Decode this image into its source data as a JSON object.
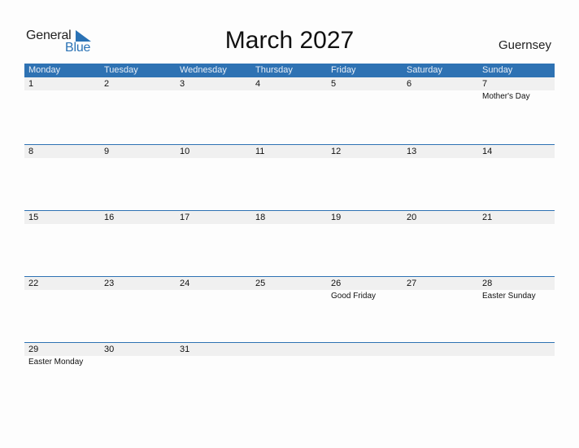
{
  "logo": {
    "word1": "General",
    "word2": "Blue",
    "icon": "triangle-flag-icon"
  },
  "title": "March 2027",
  "country": "Guernsey",
  "colors": {
    "accent": "#2e72b3",
    "date_band": "#f0f0f0"
  },
  "weekdays": [
    "Monday",
    "Tuesday",
    "Wednesday",
    "Thursday",
    "Friday",
    "Saturday",
    "Sunday"
  ],
  "weeks": [
    [
      {
        "day": "1",
        "holiday": ""
      },
      {
        "day": "2",
        "holiday": ""
      },
      {
        "day": "3",
        "holiday": ""
      },
      {
        "day": "4",
        "holiday": ""
      },
      {
        "day": "5",
        "holiday": ""
      },
      {
        "day": "6",
        "holiday": ""
      },
      {
        "day": "7",
        "holiday": "Mother's Day"
      }
    ],
    [
      {
        "day": "8",
        "holiday": ""
      },
      {
        "day": "9",
        "holiday": ""
      },
      {
        "day": "10",
        "holiday": ""
      },
      {
        "day": "11",
        "holiday": ""
      },
      {
        "day": "12",
        "holiday": ""
      },
      {
        "day": "13",
        "holiday": ""
      },
      {
        "day": "14",
        "holiday": ""
      }
    ],
    [
      {
        "day": "15",
        "holiday": ""
      },
      {
        "day": "16",
        "holiday": ""
      },
      {
        "day": "17",
        "holiday": ""
      },
      {
        "day": "18",
        "holiday": ""
      },
      {
        "day": "19",
        "holiday": ""
      },
      {
        "day": "20",
        "holiday": ""
      },
      {
        "day": "21",
        "holiday": ""
      }
    ],
    [
      {
        "day": "22",
        "holiday": ""
      },
      {
        "day": "23",
        "holiday": ""
      },
      {
        "day": "24",
        "holiday": ""
      },
      {
        "day": "25",
        "holiday": ""
      },
      {
        "day": "26",
        "holiday": "Good Friday"
      },
      {
        "day": "27",
        "holiday": ""
      },
      {
        "day": "28",
        "holiday": "Easter Sunday"
      }
    ],
    [
      {
        "day": "29",
        "holiday": "Easter Monday"
      },
      {
        "day": "30",
        "holiday": ""
      },
      {
        "day": "31",
        "holiday": ""
      },
      {
        "day": "",
        "holiday": ""
      },
      {
        "day": "",
        "holiday": ""
      },
      {
        "day": "",
        "holiday": ""
      },
      {
        "day": "",
        "holiday": ""
      }
    ]
  ]
}
